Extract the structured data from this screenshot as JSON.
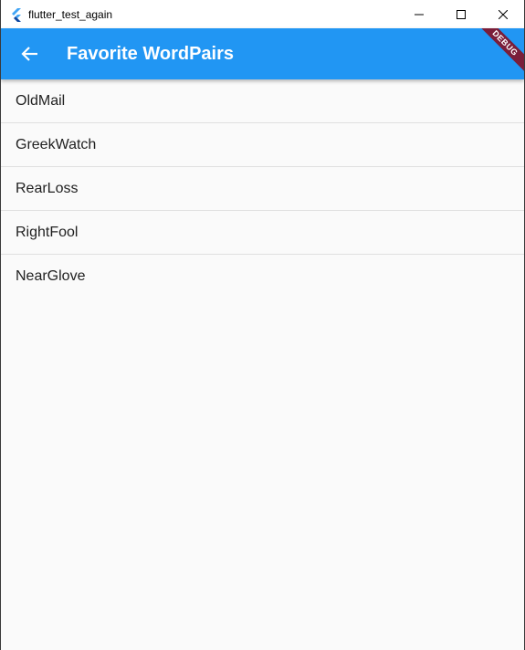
{
  "window": {
    "title": "flutter_test_again",
    "app_icon": "flutter-icon",
    "controls": [
      "minimize-icon",
      "maximize-icon",
      "close-icon"
    ]
  },
  "appbar": {
    "title": "Favorite WordPairs",
    "back_icon": "arrow-back-icon",
    "color": "#2196f3"
  },
  "debug_banner": {
    "label": "DEBUG",
    "color": "#7a1e3a"
  },
  "favorites": [
    {
      "label": "OldMail"
    },
    {
      "label": "GreekWatch"
    },
    {
      "label": "RearLoss"
    },
    {
      "label": "RightFool"
    },
    {
      "label": "NearGlove"
    }
  ]
}
